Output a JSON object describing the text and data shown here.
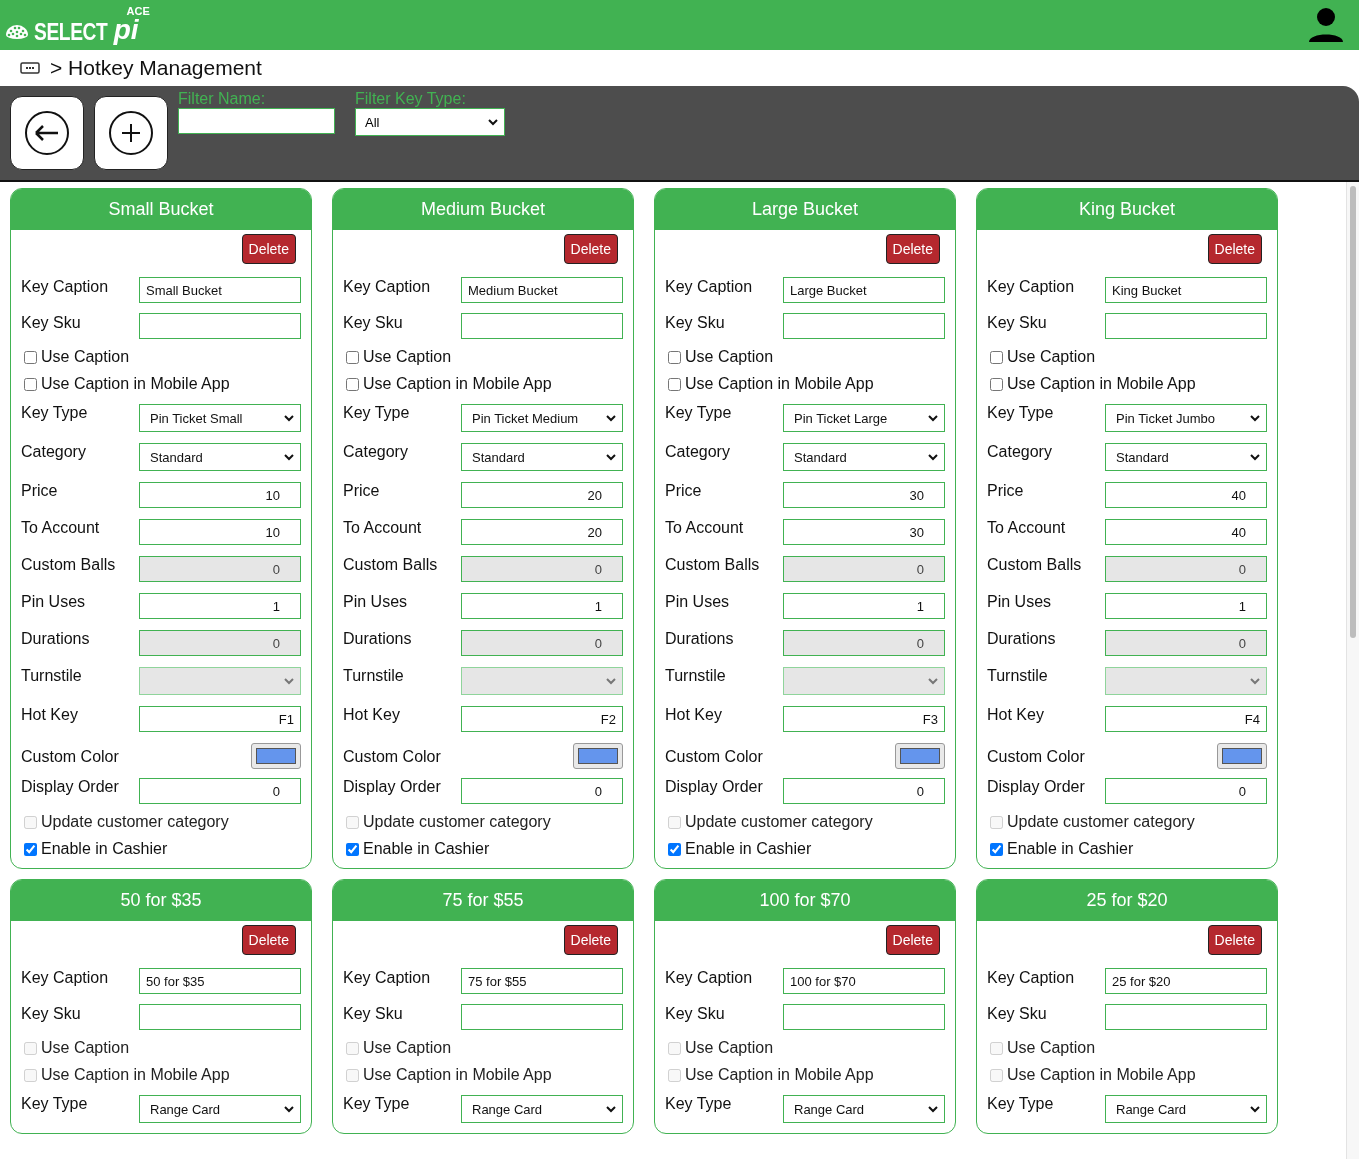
{
  "header": {
    "logo": {
      "brand": "SELECT",
      "suffix": "pi",
      "badge": "ACE"
    }
  },
  "breadcrumb": {
    "text": "> Hotkey Management"
  },
  "toolbar": {
    "filter_name": {
      "label": "Filter Name:"
    },
    "filter_key_type": {
      "label": "Filter Key Type:",
      "value": "All"
    }
  },
  "cards": [
    {
      "title": "Small Bucket",
      "delete": "Delete",
      "fields": [
        {
          "kind": "text",
          "label": "Key Caption",
          "value": "Small Bucket",
          "disabled": false
        },
        {
          "kind": "text",
          "label": "Key Sku",
          "disabled": false
        },
        {
          "kind": "checkbox",
          "label": "Use Caption",
          "checked": false,
          "disabled": false
        },
        {
          "kind": "checkbox",
          "label": "Use Caption in Mobile App",
          "checked": false,
          "disabled": false
        },
        {
          "kind": "select",
          "label": "Key Type",
          "value": "Pin Ticket Small",
          "disabled": false
        },
        {
          "kind": "select",
          "label": "Category",
          "value": "Standard",
          "disabled": false
        },
        {
          "kind": "number",
          "label": "Price",
          "value": "10",
          "disabled": false
        },
        {
          "kind": "number",
          "label": "To Account",
          "value": "10",
          "disabled": false
        },
        {
          "kind": "number",
          "label": "Custom Balls",
          "value": "0",
          "disabled": true
        },
        {
          "kind": "number",
          "label": "Pin Uses",
          "value": "1",
          "disabled": false
        },
        {
          "kind": "number",
          "label": "Durations",
          "value": "0",
          "disabled": true
        },
        {
          "kind": "select",
          "label": "Turnstile",
          "disabled": true
        },
        {
          "kind": "number",
          "label": "Hot Key",
          "value": "F1",
          "disabled": false
        },
        {
          "kind": "color",
          "label": "Custom Color",
          "color": "#6495ed"
        },
        {
          "kind": "number",
          "label": "Display Order",
          "value": "0",
          "disabled": false
        },
        {
          "kind": "checkbox",
          "label": "Update customer category",
          "checked": false,
          "disabled": true
        },
        {
          "kind": "checkbox",
          "label": "Enable in Cashier",
          "checked": true,
          "disabled": false
        }
      ]
    },
    {
      "title": "Medium Bucket",
      "delete": "Delete",
      "fields": [
        {
          "kind": "text",
          "label": "Key Caption",
          "value": "Medium Bucket",
          "disabled": false
        },
        {
          "kind": "text",
          "label": "Key Sku",
          "disabled": false
        },
        {
          "kind": "checkbox",
          "label": "Use Caption",
          "checked": false,
          "disabled": false
        },
        {
          "kind": "checkbox",
          "label": "Use Caption in Mobile App",
          "checked": false,
          "disabled": false
        },
        {
          "kind": "select",
          "label": "Key Type",
          "value": "Pin Ticket Medium",
          "disabled": false
        },
        {
          "kind": "select",
          "label": "Category",
          "value": "Standard",
          "disabled": false
        },
        {
          "kind": "number",
          "label": "Price",
          "value": "20",
          "disabled": false
        },
        {
          "kind": "number",
          "label": "To Account",
          "value": "20",
          "disabled": false
        },
        {
          "kind": "number",
          "label": "Custom Balls",
          "value": "0",
          "disabled": true
        },
        {
          "kind": "number",
          "label": "Pin Uses",
          "value": "1",
          "disabled": false
        },
        {
          "kind": "number",
          "label": "Durations",
          "value": "0",
          "disabled": true
        },
        {
          "kind": "select",
          "label": "Turnstile",
          "disabled": true
        },
        {
          "kind": "number",
          "label": "Hot Key",
          "value": "F2",
          "disabled": false
        },
        {
          "kind": "color",
          "label": "Custom Color",
          "color": "#6495ed"
        },
        {
          "kind": "number",
          "label": "Display Order",
          "value": "0",
          "disabled": false
        },
        {
          "kind": "checkbox",
          "label": "Update customer category",
          "checked": false,
          "disabled": true
        },
        {
          "kind": "checkbox",
          "label": "Enable in Cashier",
          "checked": true,
          "disabled": false
        }
      ]
    },
    {
      "title": "Large Bucket",
      "delete": "Delete",
      "fields": [
        {
          "kind": "text",
          "label": "Key Caption",
          "value": "Large Bucket",
          "disabled": false
        },
        {
          "kind": "text",
          "label": "Key Sku",
          "disabled": false
        },
        {
          "kind": "checkbox",
          "label": "Use Caption",
          "checked": false,
          "disabled": false
        },
        {
          "kind": "checkbox",
          "label": "Use Caption in Mobile App",
          "checked": false,
          "disabled": false
        },
        {
          "kind": "select",
          "label": "Key Type",
          "value": "Pin Ticket Large",
          "disabled": false
        },
        {
          "kind": "select",
          "label": "Category",
          "value": "Standard",
          "disabled": false
        },
        {
          "kind": "number",
          "label": "Price",
          "value": "30",
          "disabled": false
        },
        {
          "kind": "number",
          "label": "To Account",
          "value": "30",
          "disabled": false
        },
        {
          "kind": "number",
          "label": "Custom Balls",
          "value": "0",
          "disabled": true
        },
        {
          "kind": "number",
          "label": "Pin Uses",
          "value": "1",
          "disabled": false
        },
        {
          "kind": "number",
          "label": "Durations",
          "value": "0",
          "disabled": true
        },
        {
          "kind": "select",
          "label": "Turnstile",
          "disabled": true
        },
        {
          "kind": "number",
          "label": "Hot Key",
          "value": "F3",
          "disabled": false
        },
        {
          "kind": "color",
          "label": "Custom Color",
          "color": "#6495ed"
        },
        {
          "kind": "number",
          "label": "Display Order",
          "value": "0",
          "disabled": false
        },
        {
          "kind": "checkbox",
          "label": "Update customer category",
          "checked": false,
          "disabled": true
        },
        {
          "kind": "checkbox",
          "label": "Enable in Cashier",
          "checked": true,
          "disabled": false
        }
      ]
    },
    {
      "title": "King Bucket",
      "delete": "Delete",
      "fields": [
        {
          "kind": "text",
          "label": "Key Caption",
          "value": "King Bucket",
          "disabled": false
        },
        {
          "kind": "text",
          "label": "Key Sku",
          "disabled": false
        },
        {
          "kind": "checkbox",
          "label": "Use Caption",
          "checked": false,
          "disabled": false
        },
        {
          "kind": "checkbox",
          "label": "Use Caption in Mobile App",
          "checked": false,
          "disabled": false
        },
        {
          "kind": "select",
          "label": "Key Type",
          "value": "Pin Ticket Jumbo",
          "disabled": false
        },
        {
          "kind": "select",
          "label": "Category",
          "value": "Standard",
          "disabled": false
        },
        {
          "kind": "number",
          "label": "Price",
          "value": "40",
          "disabled": false
        },
        {
          "kind": "number",
          "label": "To Account",
          "value": "40",
          "disabled": false
        },
        {
          "kind": "number",
          "label": "Custom Balls",
          "value": "0",
          "disabled": true
        },
        {
          "kind": "number",
          "label": "Pin Uses",
          "value": "1",
          "disabled": false
        },
        {
          "kind": "number",
          "label": "Durations",
          "value": "0",
          "disabled": true
        },
        {
          "kind": "select",
          "label": "Turnstile",
          "disabled": true
        },
        {
          "kind": "number",
          "label": "Hot Key",
          "value": "F4",
          "disabled": false
        },
        {
          "kind": "color",
          "label": "Custom Color",
          "color": "#6495ed"
        },
        {
          "kind": "number",
          "label": "Display Order",
          "value": "0",
          "disabled": false
        },
        {
          "kind": "checkbox",
          "label": "Update customer category",
          "checked": false,
          "disabled": true
        },
        {
          "kind": "checkbox",
          "label": "Enable in Cashier",
          "checked": true,
          "disabled": false
        }
      ]
    },
    {
      "title": "50 for $35",
      "delete": "Delete",
      "fields": [
        {
          "kind": "text",
          "label": "Key Caption",
          "value": "50 for $35",
          "disabled": false
        },
        {
          "kind": "text",
          "label": "Key Sku",
          "disabled": false
        },
        {
          "kind": "checkbox",
          "label": "Use Caption",
          "checked": false,
          "disabled": true
        },
        {
          "kind": "checkbox",
          "label": "Use Caption in Mobile App",
          "checked": false,
          "disabled": true
        },
        {
          "kind": "select",
          "label": "Key Type",
          "value": "Range Card",
          "disabled": false
        }
      ]
    },
    {
      "title": "75 for $55",
      "delete": "Delete",
      "fields": [
        {
          "kind": "text",
          "label": "Key Caption",
          "value": "75 for $55",
          "disabled": false
        },
        {
          "kind": "text",
          "label": "Key Sku",
          "disabled": false
        },
        {
          "kind": "checkbox",
          "label": "Use Caption",
          "checked": false,
          "disabled": true
        },
        {
          "kind": "checkbox",
          "label": "Use Caption in Mobile App",
          "checked": false,
          "disabled": true
        },
        {
          "kind": "select",
          "label": "Key Type",
          "value": "Range Card",
          "disabled": false
        }
      ]
    },
    {
      "title": "100 for $70",
      "delete": "Delete",
      "fields": [
        {
          "kind": "text",
          "label": "Key Caption",
          "value": "100 for $70",
          "disabled": false
        },
        {
          "kind": "text",
          "label": "Key Sku",
          "disabled": false
        },
        {
          "kind": "checkbox",
          "label": "Use Caption",
          "checked": false,
          "disabled": true
        },
        {
          "kind": "checkbox",
          "label": "Use Caption in Mobile App",
          "checked": false,
          "disabled": true
        },
        {
          "kind": "select",
          "label": "Key Type",
          "value": "Range Card",
          "disabled": false
        }
      ]
    },
    {
      "title": "25 for $20",
      "delete": "Delete",
      "fields": [
        {
          "kind": "text",
          "label": "Key Caption",
          "value": "25 for $20",
          "disabled": false
        },
        {
          "kind": "text",
          "label": "Key Sku",
          "disabled": false
        },
        {
          "kind": "checkbox",
          "label": "Use Caption",
          "checked": false,
          "disabled": true
        },
        {
          "kind": "checkbox",
          "label": "Use Caption in Mobile App",
          "checked": false,
          "disabled": true
        },
        {
          "kind": "select",
          "label": "Key Type",
          "value": "Range Card",
          "disabled": false
        }
      ]
    }
  ]
}
